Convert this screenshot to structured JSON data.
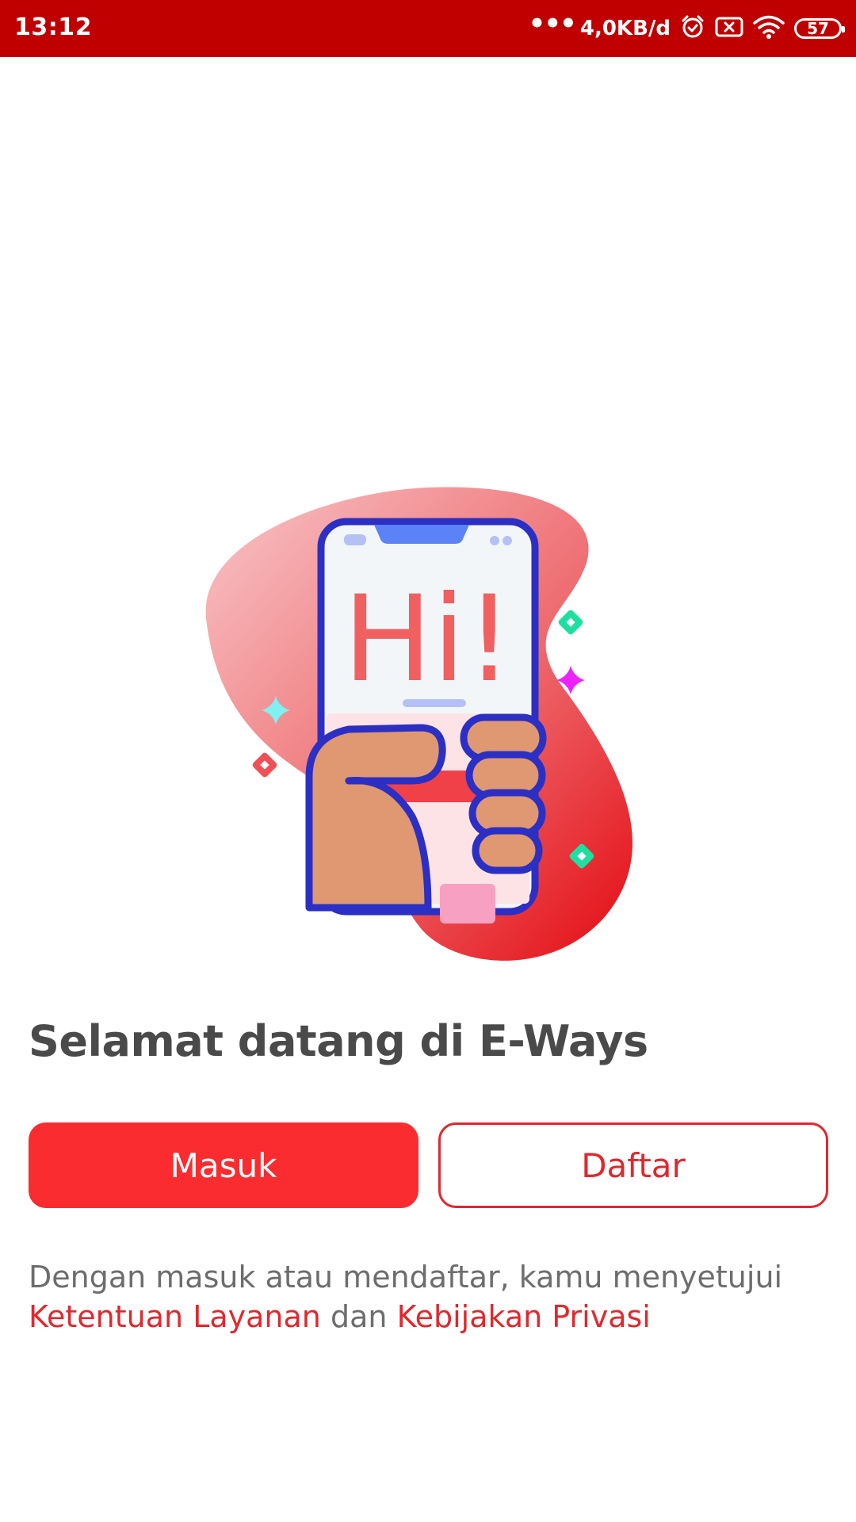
{
  "status_bar": {
    "time": "13:12",
    "dots": "•••",
    "network_speed": "4,0KB/d",
    "battery_level": "57",
    "icons": [
      "alarm-icon",
      "sim-disabled-icon",
      "wifi-icon",
      "battery-icon"
    ]
  },
  "illustration": {
    "screen_text": "Hi!",
    "icon": "hand-holding-phone-illustration"
  },
  "welcome": {
    "title": "Selamat datang di E-Ways"
  },
  "buttons": {
    "login_label": "Masuk",
    "register_label": "Daftar"
  },
  "terms": {
    "prefix": "Dengan masuk atau mendaftar, kamu menyetujui",
    "terms_link": "Ketentuan Layanan",
    "conjunction": "dan",
    "privacy_link": "Kebijakan Privasi"
  },
  "colors": {
    "status_bar": "#c00000",
    "primary": "#fa2c2f",
    "primary_text": "#e0282e",
    "title_text": "#4a4a4a",
    "body_text": "#6d6d6d"
  }
}
